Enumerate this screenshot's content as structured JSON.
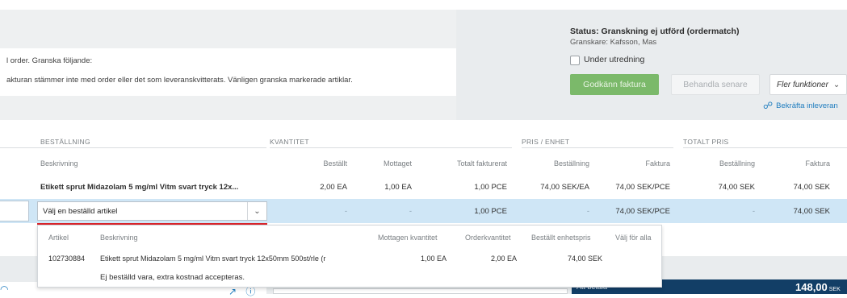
{
  "status": {
    "title": "Status: Granskning ej utförd (ordermatch)",
    "reviewer": "Granskare: Kafsson, Mas",
    "under_investigation_label": "Under utredning",
    "under_investigation_checked": false
  },
  "message": {
    "line1": "l order. Granska följande:",
    "line2": "akturan stämmer inte med order eller det som leveranskvitterats. Vänligen granska markerade artiklar."
  },
  "actions": {
    "approve_label": "Godkänn faktura",
    "later_label": "Behandla senare",
    "more_label": "Fler funktioner",
    "confirm_delivery_label": "Bekräfta inleveran"
  },
  "table": {
    "groups": {
      "order": "BESTÄLLNING",
      "quantity": "KVANTITET",
      "price_unit": "PRIS / ENHET",
      "total_price": "TOTALT PRIS"
    },
    "columns": {
      "description": "Beskrivning",
      "ordered": "Beställt",
      "received": "Mottaget",
      "total_invoiced": "Totalt fakturerat",
      "price_order": "Beställning",
      "price_invoice": "Faktura",
      "total_order": "Beställning",
      "total_invoice": "Faktura"
    },
    "row1": {
      "description": "Etikett sprut Midazolam 5 mg/ml Vitm svart tryck 12x...",
      "ordered": "2,00 EA",
      "received": "1,00 EA",
      "total_invoiced": "1,00 PCE",
      "price_order": "74,00 SEK/EA",
      "price_invoice": "74,00 SEK/PCE",
      "total_order": "74,00 SEK",
      "total_invoice": "74,00 SEK"
    },
    "row2": {
      "select_value": "Välj en beställd artikel",
      "ordered": "-",
      "received": "-",
      "total_invoiced": "1,00 PCE",
      "price_order": "-",
      "price_invoice": "74,00 SEK/PCE",
      "total_order": "-",
      "total_invoice": "74,00 SEK"
    }
  },
  "dropdown": {
    "headers": {
      "article": "Artikel",
      "description": "Beskrivning",
      "received_qty": "Mottagen kvantitet",
      "order_qty": "Orderkvantitet",
      "ordered_unit_price": "Beställt enhetspris",
      "select_all": "Välj för alla"
    },
    "item": {
      "article": "102730884",
      "description": "Etikett sprut Midazolam 5 mg/ml Vitm svart tryck 12x50mm 500st/rle (r",
      "received_qty": "1,00 EA",
      "order_qty": "2,00 EA",
      "ordered_unit_price": "74,00 SEK"
    },
    "extra_option": "Ej beställd vara, extra kostnad accepteras."
  },
  "footer": {
    "pay_label": "Att betala",
    "pay_amount": "148,00",
    "pay_currency": "SEK"
  },
  "icons": {
    "confirm": "delivery-icon",
    "chevron": "chevron-down-icon",
    "expand": "expand-icon",
    "info": "info-icon"
  }
}
